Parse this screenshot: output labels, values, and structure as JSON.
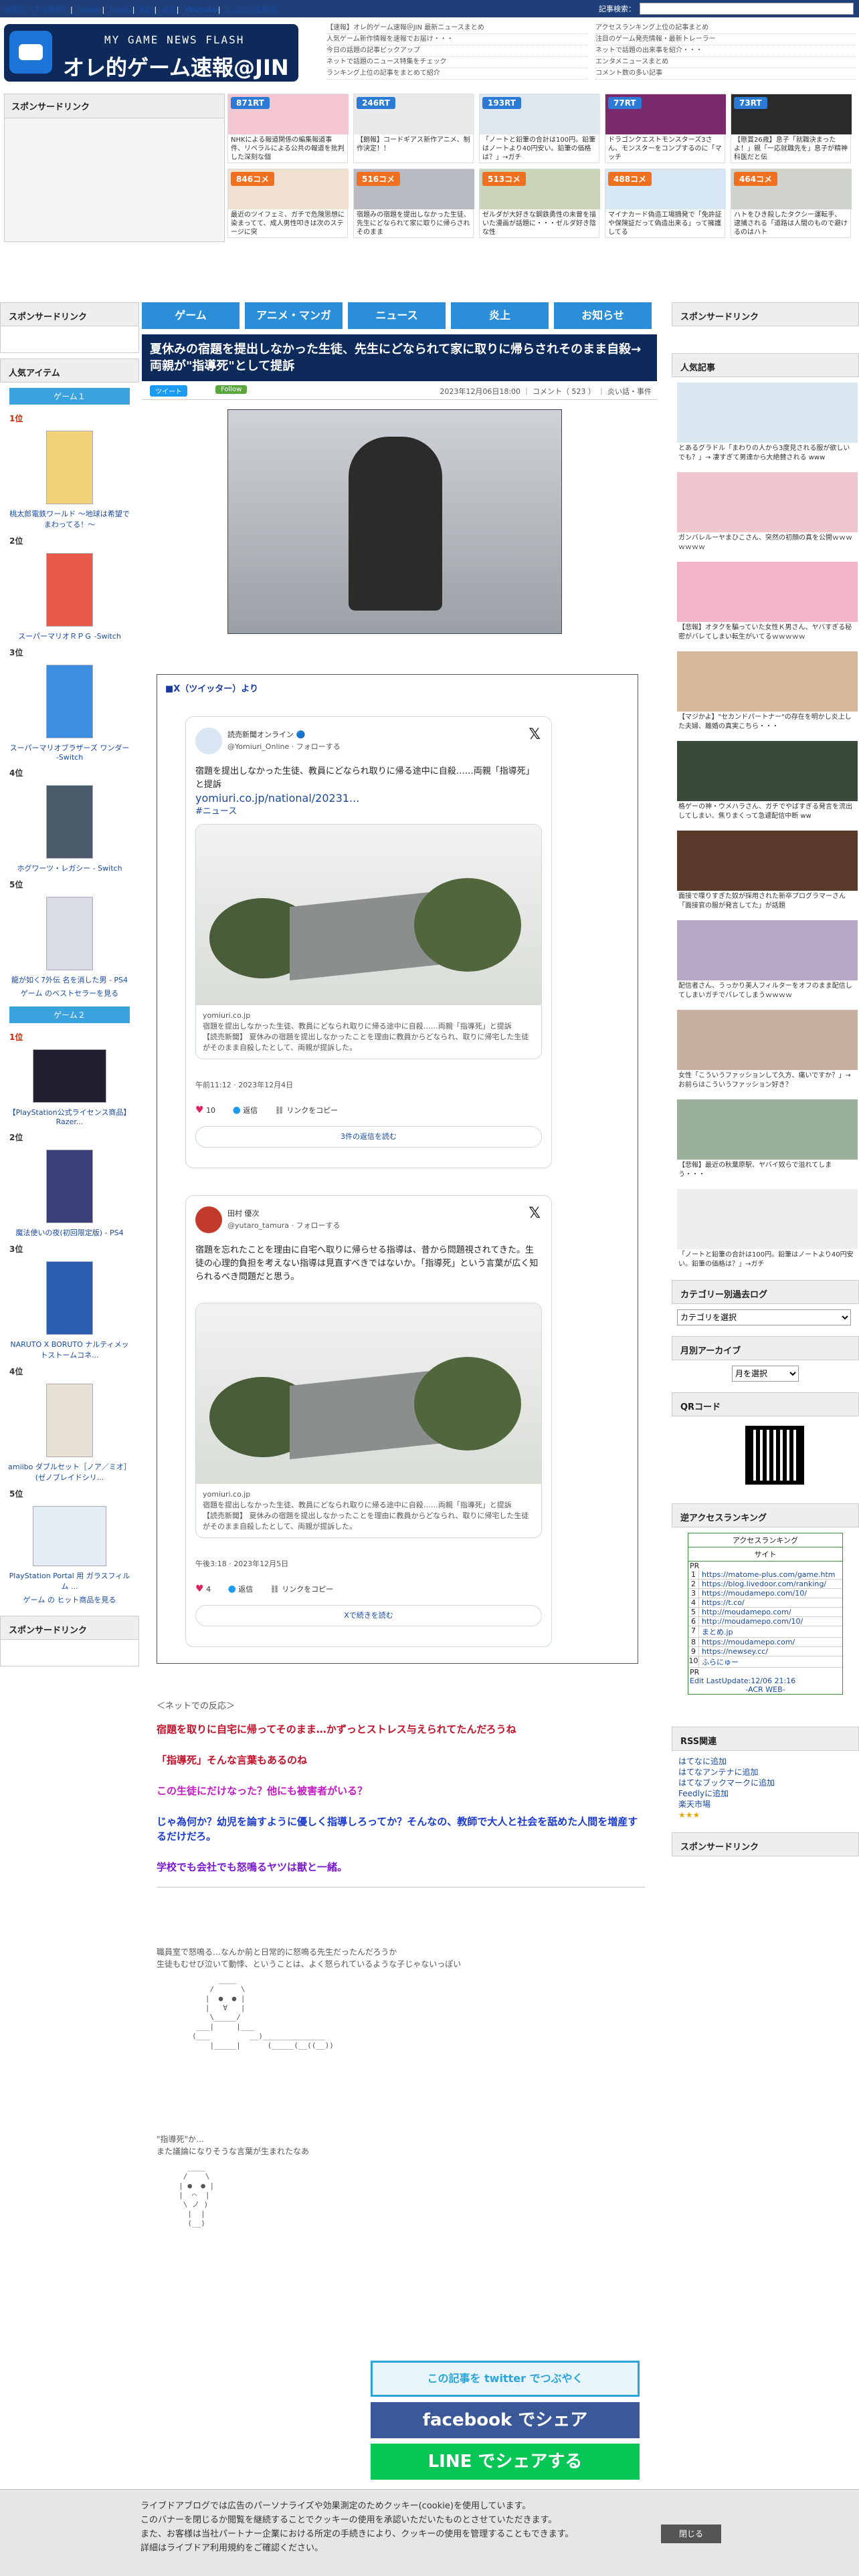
{
  "topbar": {
    "links": [
      "速報元（ネタ投稿）",
      "twitter",
      "feedly",
      "RSS",
      "楽天",
      "Youtube",
      "ニコニコ生放送"
    ],
    "search_label": "記事検索："
  },
  "header": {
    "logo_line1": "MY GAME NEWS FLASH",
    "logo_line2": "オレ的ゲーム速報@JIN",
    "news_col1": [
      "【速報】オレ的ゲーム速報＠JIN 最新ニュースまとめ",
      "人気ゲーム新作情報を速報でお届け・・・",
      "今日の話題の記事ピックアップ",
      "ネットで話題のニュース特集をチェック",
      "ランキング上位の記事をまとめて紹介"
    ],
    "news_col2": [
      "アクセスランキング上位の記事まとめ",
      "注目のゲーム発売情報・最新トレーラー",
      "ネットで話題の出来事を紹介・・・",
      "エンタメニュースまとめ",
      "コメント数の多い記事"
    ]
  },
  "sponsor_label": "スポンサードリンク",
  "thumbs": [
    {
      "badge": "871RT",
      "type": "rt",
      "caption": "NHKによる報道関係の編集報道事件、リベラルによる公共の報道を批判した深刻な個"
    },
    {
      "badge": "246RT",
      "type": "rt",
      "caption": "【朗報】コードギアス新作アニメ、制作決定！！"
    },
    {
      "badge": "193RT",
      "type": "rt",
      "caption": "「ノートと鉛筆の合計は100円。鉛筆はノートより40円安い。鉛筆の価格は？」→ガチ"
    },
    {
      "badge": "77RT",
      "type": "rt",
      "caption": "ドラゴンクエストモンスターズ3さん、モンスターをコンプするのに「マッチ"
    },
    {
      "badge": "73RT",
      "type": "rt",
      "caption": "【懸賞26歳】息子「就職決まったよ！」親「一応就職先を」息子が精神科医だと伝"
    },
    {
      "badge": "846コメ",
      "type": "cm",
      "caption": "最近のツイフェミ、ガチで危険思想に染まってて、成人男性叩きは次のステージに突"
    },
    {
      "badge": "516コメ",
      "type": "cm",
      "caption": "宿題みの宿題を提出しなかった生徒、先生にどなられて家に取りに帰らされそのまま"
    },
    {
      "badge": "513コメ",
      "type": "cm",
      "caption": "ゼルダが大好きな鋼鉄勇性の未曾を描いた漫画が話題に・・・ゼルダ好き陰な性"
    },
    {
      "badge": "488コメ",
      "type": "cm",
      "caption": "マイナカード偽造工場摘発で「免許証や保険証だって偽造出来る」って擁護してる"
    },
    {
      "badge": "464コメ",
      "type": "cm",
      "caption": "ハトをひき殺したタクシー運転手、逮捕される「道路は人間のもので避けるのはハト"
    }
  ],
  "nav": [
    "ゲーム",
    "アニメ・マンガ",
    "ニュース",
    "炎上",
    "お知らせ"
  ],
  "left": {
    "popular_title": "人気アイテム",
    "game1_label": "ゲーム１",
    "ranks1": [
      {
        "rank": "1位",
        "name": "桃太郎電鉄ワールド ～地球は希望でまわってる！～"
      },
      {
        "rank": "2位",
        "name": "スーパーマリオＲＰＧ -Switch"
      },
      {
        "rank": "3位",
        "name": "スーパーマリオブラザーズ ワンダー -Switch"
      },
      {
        "rank": "4位",
        "name": "ホグワーツ・レガシー - Switch"
      },
      {
        "rank": "5位",
        "name": "龍が如く7外伝 名を消した男 - PS4"
      }
    ],
    "best1": "ゲーム のベストセラーを見る",
    "game2_label": "ゲーム２",
    "ranks2": [
      {
        "rank": "1位",
        "name": "【PlayStation公式ライセンス商品】 Razer..."
      },
      {
        "rank": "2位",
        "name": "魔法使いの夜(初回限定版) - PS4"
      },
      {
        "rank": "3位",
        "name": "NARUTO X BORUTO ナルティメットストームコネ..."
      },
      {
        "rank": "4位",
        "name": "amiibo ダブルセット［ノア／ミオ］(ゼノブレイドシリ..."
      },
      {
        "rank": "5位",
        "name": "PlayStation Portal 用 ガラスフィルム ..."
      }
    ],
    "hit2": "ゲーム の ヒット商品を見る",
    "sponsor": "スポンサードリンク"
  },
  "article": {
    "title": "夏休みの宿題を提出しなかった生徒、先生にどなられて家に取りに帰らされそのまま自殺→両親が\"指導死\"として提訴",
    "tweet_btn": "ツイート",
    "follow_btn": "Follow",
    "meta": "2023年12月06日18:00 ｜ コメント（ 523 ） ｜ 炎い話・事件",
    "embed_header": "■X（ツイッター）より",
    "tweet1": {
      "name": "読売新聞オンライン 🔵",
      "handle": "@Yomiuri_Online · フォローする",
      "text": "宿題を提出しなかった生徒、教員にどなられ取りに帰る途中に自殺……両親「指導死」と提訴",
      "link": "yomiuri.co.jp/national/20231...",
      "hashtag": "#ニュース",
      "card_domain": "yomiuri.co.jp",
      "card_title": "宿題を提出しなかった生徒、教員にどなられ取りに帰る途中に自殺……両親「指導死」と提訴",
      "card_desc": "【読売新聞】 夏休みの宿題を提出しなかったことを理由に教員からどなられ、取りに帰宅した生徒がそのまま自殺したとして、両親が提訴した。",
      "time": "午前11:12 · 2023年12月4日",
      "likes": "10",
      "reply": "返信",
      "copy": "リンクをコピー",
      "more": "3件の返信を読む"
    },
    "tweet2": {
      "name": "田村 優次",
      "handle": "@yutaro_tamura · フォローする",
      "text": "宿題を忘れたことを理由に自宅へ取りに帰らせる指導は、昔から問題視されてきた。生徒の心理的負担を考えない指導は見直すべきではないか。「指導死」という言葉が広く知られるべき問題だと思う。",
      "card_domain": "yomiuri.co.jp",
      "card_title": "宿題を提出しなかった生徒、教員にどなられ取りに帰る途中に自殺……両親「指導死」と提訴",
      "card_desc": "【読売新聞】 夏休みの宿題を提出しなかったことを理由に教員からどなられ、取りに帰宅した生徒がそのまま自殺したとして、両親が提訴した。",
      "time": "午後3:18 · 2023年12月5日",
      "likes": "4",
      "reply": "返信",
      "copy": "リンクをコピー",
      "more": "Xで続きを読む"
    },
    "reactions_src": "＜ネットでの反応＞",
    "reactions": [
      {
        "text": "宿題を取りに自宅に帰ってそのまま…かずっとストレス与えられてたんだろうね",
        "color": "#c0122a"
      },
      {
        "text": "「指導死」そんな言葉もあるのね",
        "color": "#c0122a"
      },
      {
        "text": "この生徒にだけなった？他にも被害者がいる？",
        "color": "#c01ac0"
      },
      {
        "text": "じゃ為何か？幼児を論すように優しく指導しろってか？そんなの、教師で大人と社会を舐めた人間を増産するだけだろ。",
        "color": "#1a3ad0"
      },
      {
        "text": "学校でも会社でも怒鳴るヤツは獣と一緒。",
        "color": "#7a1ad0"
      }
    ],
    "aa1_text": "職員室で怒鳴る…なんか前と日常的に怒鳴る先生だったんだろうか\n生徒もむせび泣いて動悸、ということは、よく怒られているような子じゃないっぽい",
    "aa2_text": "\"指導死\"か…\nまた議論になりそうな言葉が生まれたなあ",
    "share_tw": "この記事を twitter でつぶやく",
    "share_fb": "facebook でシェア",
    "share_line": "LINE でシェアする"
  },
  "right": {
    "sponsor": "スポンサードリンク",
    "popular": "人気記事",
    "items": [
      "とあるグラドル「まわりの人から3度見される服が欲しいでも？」→ 凄すぎて男達から大絶賛される www",
      "ガンバレルーヤまひこさん、突然の初顔の真を公開ｗｗｗｗｗｗｗ",
      "【悲報】オタクを騙っていた女性Ｋ男さん、ヤバすぎる秘密がバレてしまい転生がいてるｗｗｗｗｗ",
      "【マジかよ】\"セカンドパートナー\"の存在を明かし炎上した夫婦、離婚の真実こちら・・・",
      "格ゲーの神・ウメハラさん、ガチでやばすぎる発言を流出してしまい、焦りまくって急遽配信中断 ww",
      "面接で喋りすぎた奴が採用された新卒プログラマーさん「面接官の服が発言してた」が話題",
      "配信者さん、うっかり美人フィルターをオフのまま配信してしまいガチでバレてしまうｗｗｗｗ",
      "女性「こういうファッションして久方、痛いですか？」→ お前らはこういうファッション好き？",
      "【悲報】最近の秋葉原駅、ヤバイ奴らで溢れてしまう・・・",
      "「ノートと鉛筆の合計は100円。鉛筆はノートより40円安い。鉛筆の価格は？」→ガチ"
    ],
    "cat_title": "カテゴリー別過去ログ",
    "cat_select": "カテゴリを選択",
    "month_title": "月別アーカイブ",
    "month_select": "月を選択",
    "qr_title": "QRコード",
    "reverse_title": "逆アクセスランキング",
    "acc_head1": "アクセスランキング",
    "acc_head2": "サイト",
    "acc_rows": [
      "https://matome-plus.com/game.htm",
      "https://blog.livedoor.com/ranking/",
      "https://moudamepo.com/10/",
      "https://t.co/",
      "http://moudamepo.com/",
      "http://moudamepo.com/10/",
      "まとめ.jp",
      "https://moudamepo.com/",
      "https://newsey.cc/",
      "ふらにゅー"
    ],
    "acc_pr": "PR",
    "acc_update": "Edit LastUpdate:12/06 21:16",
    "acc_footer": "-ACR WEB-",
    "rss_title": "RSS関連",
    "rss_links": [
      "はてなに追加",
      "はてなアンテナに追加",
      "はてなブックマークに追加",
      "Feedlyに追加",
      "楽天市場"
    ],
    "sponsor2": "スポンサードリンク"
  },
  "cookie": {
    "line1": "ライブドアブログでは広告のパーソナライズや効果測定のためクッキー(cookie)を使用しています。",
    "line2": "このバナーを閉じるか閲覧を継続することでクッキーの使用を承認いただいたものとさせていただきます。",
    "line3": "また、お客様は当社パートナー企業における所定の手続きにより、クッキーの使用を管理することもできます。",
    "line4": "詳細はライブドア利用規約をご確認ください。",
    "close": "閉じる"
  },
  "colors": {
    "brand": "#0d2a5a",
    "nav": "#2a8fd8",
    "rt": "#2b7ad6",
    "comment": "#f07020"
  }
}
